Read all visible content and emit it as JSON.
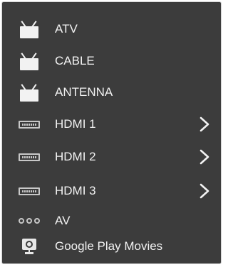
{
  "inputs": [
    {
      "label": "ATV",
      "icon": "tv-icon",
      "has_submenu": false
    },
    {
      "label": "CABLE",
      "icon": "tv-icon",
      "has_submenu": false
    },
    {
      "label": "ANTENNA",
      "icon": "tv-icon",
      "has_submenu": false
    },
    {
      "label": "HDMI 1",
      "icon": "hdmi-icon",
      "has_submenu": true
    },
    {
      "label": "HDMI 2",
      "icon": "hdmi-icon",
      "has_submenu": true
    },
    {
      "label": "HDMI 3",
      "icon": "hdmi-icon",
      "has_submenu": true
    },
    {
      "label": "AV",
      "icon": "av-icon",
      "has_submenu": false
    },
    {
      "label": "Google Play Movies",
      "icon": "play-movies-icon",
      "has_submenu": false
    }
  ],
  "colors": {
    "panel_background": "#3c3c3c",
    "text": "#f2f2f2",
    "icon": "#c8c8c8"
  }
}
